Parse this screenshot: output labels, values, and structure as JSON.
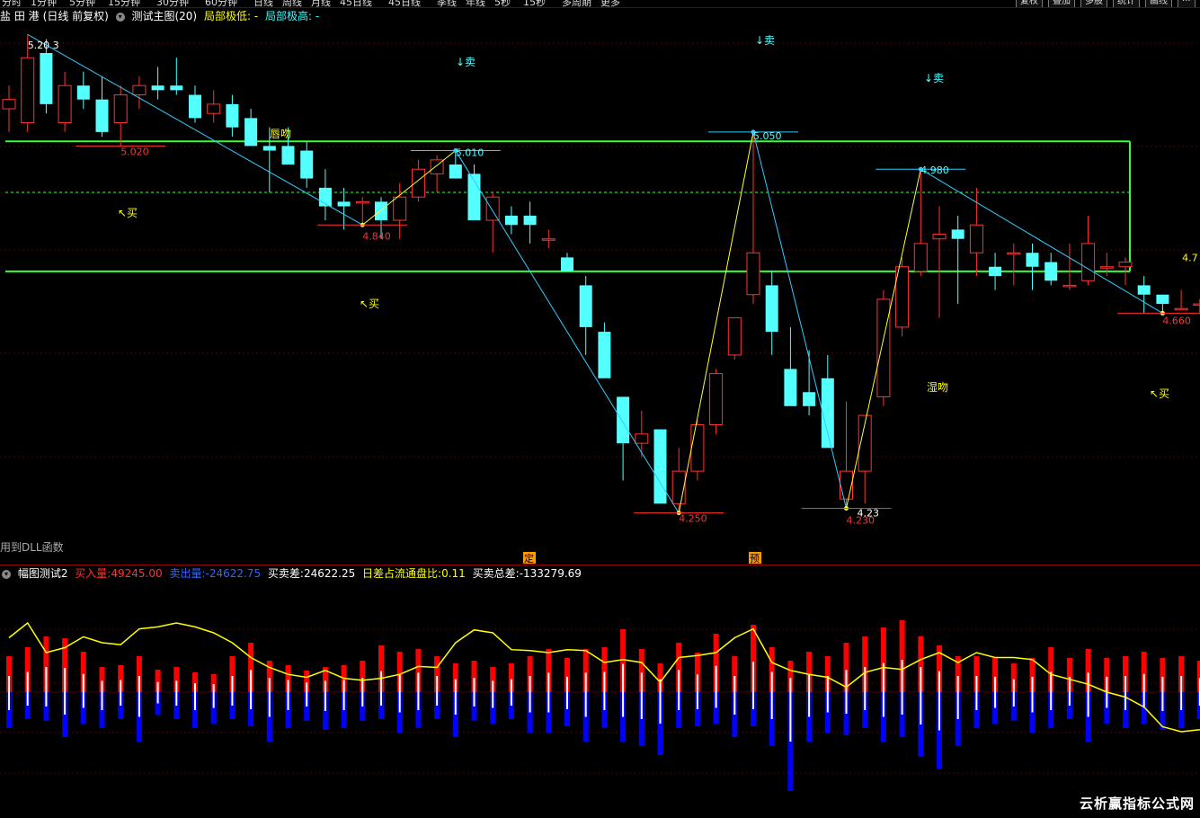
{
  "topbar": {
    "periods": [
      "分时",
      "1分钟",
      "5分钟",
      "15分钟",
      "30分钟",
      "60分钟",
      "日线",
      "周线",
      "月线",
      "45日线",
      "45日线",
      "季线",
      "年线",
      "5秒",
      "15秒",
      "多周期",
      "更多"
    ],
    "right_buttons": [
      "复权",
      "叠加",
      "多股",
      "统计",
      "画线",
      "···"
    ]
  },
  "main_header": {
    "stock_name": "盐 田 港",
    "mode": "(日线 前复权)",
    "indicator": "测试主图(20)",
    "low_label": "局部极低: -",
    "high_label": "局部极高: -",
    "colors": {
      "name": "#ffffff",
      "indicator": "#ffffff",
      "low": "#ffff00",
      "high": "#33ffff"
    }
  },
  "dll_note": "用到DLL函数",
  "ind_header": {
    "name": "幅图测试2",
    "buy_label": "买入量:",
    "buy_value": "49245.00",
    "sell_label": "卖出量:",
    "sell_value": "-24622.75",
    "diff_label": "买卖差:",
    "diff_value": "24622.25",
    "ratio_label": "日差占流通盘比:",
    "ratio_value": "0.11",
    "total_label": "买卖总差:",
    "total_value": "-133279.69"
  },
  "watermark": "云析赢指标公式网",
  "chart_data": {
    "type": "candlestick",
    "price_labels": {
      "p1": "5.20 3",
      "p2": "5.020",
      "p3": "4.840",
      "p4": "5.010",
      "p5": "4.250",
      "p6": "5.050",
      "p7": "4.23",
      "p8": "4.230",
      "p9": "4.980",
      "p10": "4.660",
      "p11": "4.7"
    },
    "annotations": {
      "sell1": "↓卖",
      "sell2": "↓卖",
      "sell3": "↓卖",
      "buy1": "↖买",
      "buy2": "↖买",
      "buy3": "↖买",
      "kiss1": "唇吻",
      "kiss2": "湿吻",
      "mark1": "定",
      "mark2": "预"
    },
    "box": {
      "top": 5.03,
      "bottom": 4.75,
      "mid": 4.92
    },
    "ylim": [
      4.15,
      5.28
    ],
    "colors": {
      "up": "#ff3333",
      "down": "#54ffff",
      "box": "#33ff33",
      "wave": "#33ccff",
      "wave_up": "#ffff33",
      "yellow_line": "#ffff00",
      "buy_bar": "#ff0000",
      "sell_bar": "#0000ff"
    },
    "candles": [
      {
        "o": 5.1,
        "h": 5.15,
        "l": 5.05,
        "c": 5.12
      },
      {
        "o": 5.07,
        "h": 5.26,
        "l": 5.05,
        "c": 5.21
      },
      {
        "o": 5.22,
        "h": 5.25,
        "l": 5.09,
        "c": 5.11
      },
      {
        "o": 5.07,
        "h": 5.18,
        "l": 5.05,
        "c": 5.15
      },
      {
        "o": 5.15,
        "h": 5.18,
        "l": 5.1,
        "c": 5.12
      },
      {
        "o": 5.12,
        "h": 5.17,
        "l": 5.04,
        "c": 5.05
      },
      {
        "o": 5.07,
        "h": 5.15,
        "l": 5.02,
        "c": 5.13
      },
      {
        "o": 5.13,
        "h": 5.17,
        "l": 5.1,
        "c": 5.15
      },
      {
        "o": 5.15,
        "h": 5.19,
        "l": 5.12,
        "c": 5.14
      },
      {
        "o": 5.15,
        "h": 5.21,
        "l": 5.13,
        "c": 5.14
      },
      {
        "o": 5.13,
        "h": 5.15,
        "l": 5.07,
        "c": 5.08
      },
      {
        "o": 5.09,
        "h": 5.14,
        "l": 5.07,
        "c": 5.11
      },
      {
        "o": 5.11,
        "h": 5.13,
        "l": 5.04,
        "c": 5.06
      },
      {
        "o": 5.08,
        "h": 5.1,
        "l": 5.02,
        "c": 5.02
      },
      {
        "o": 5.02,
        "h": 5.06,
        "l": 4.92,
        "c": 5.01
      },
      {
        "o": 5.02,
        "h": 5.06,
        "l": 4.99,
        "c": 4.98
      },
      {
        "o": 5.01,
        "h": 5.03,
        "l": 4.93,
        "c": 4.95
      },
      {
        "o": 4.93,
        "h": 4.97,
        "l": 4.86,
        "c": 4.89
      },
      {
        "o": 4.9,
        "h": 4.93,
        "l": 4.84,
        "c": 4.89
      },
      {
        "o": 4.9,
        "h": 4.91,
        "l": 4.85,
        "c": 4.9
      },
      {
        "o": 4.9,
        "h": 4.91,
        "l": 4.82,
        "c": 4.86
      },
      {
        "o": 4.86,
        "h": 4.94,
        "l": 4.82,
        "c": 4.91
      },
      {
        "o": 4.91,
        "h": 4.99,
        "l": 4.9,
        "c": 4.97
      },
      {
        "o": 4.96,
        "h": 5.0,
        "l": 4.92,
        "c": 4.99
      },
      {
        "o": 4.98,
        "h": 5.01,
        "l": 4.95,
        "c": 4.95
      },
      {
        "o": 4.96,
        "h": 4.98,
        "l": 4.88,
        "c": 4.86
      },
      {
        "o": 4.86,
        "h": 4.92,
        "l": 4.79,
        "c": 4.91
      },
      {
        "o": 4.87,
        "h": 4.89,
        "l": 4.83,
        "c": 4.85
      },
      {
        "o": 4.87,
        "h": 4.9,
        "l": 4.81,
        "c": 4.85
      },
      {
        "o": 4.82,
        "h": 4.84,
        "l": 4.8,
        "c": 4.82
      },
      {
        "o": 4.78,
        "h": 4.79,
        "l": 4.75,
        "c": 4.75
      },
      {
        "o": 4.72,
        "h": 4.74,
        "l": 4.57,
        "c": 4.63
      },
      {
        "o": 4.62,
        "h": 4.64,
        "l": 4.55,
        "c": 4.52
      },
      {
        "o": 4.48,
        "h": 4.48,
        "l": 4.3,
        "c": 4.38
      },
      {
        "o": 4.38,
        "h": 4.45,
        "l": 4.35,
        "c": 4.4
      },
      {
        "o": 4.41,
        "h": 4.41,
        "l": 4.26,
        "c": 4.25
      },
      {
        "o": 4.25,
        "h": 4.37,
        "l": 4.23,
        "c": 4.32
      },
      {
        "o": 4.32,
        "h": 4.43,
        "l": 4.3,
        "c": 4.42
      },
      {
        "o": 4.42,
        "h": 4.54,
        "l": 4.4,
        "c": 4.53
      },
      {
        "o": 4.57,
        "h": 4.63,
        "l": 4.56,
        "c": 4.65
      },
      {
        "o": 4.7,
        "h": 5.05,
        "l": 4.68,
        "c": 4.79
      },
      {
        "o": 4.72,
        "h": 4.75,
        "l": 4.57,
        "c": 4.62
      },
      {
        "o": 4.54,
        "h": 4.63,
        "l": 4.49,
        "c": 4.46
      },
      {
        "o": 4.49,
        "h": 4.58,
        "l": 4.44,
        "c": 4.46
      },
      {
        "o": 4.52,
        "h": 4.57,
        "l": 4.39,
        "c": 4.37
      },
      {
        "o": 4.26,
        "h": 4.47,
        "l": 4.24,
        "c": 4.32
      },
      {
        "o": 4.32,
        "h": 4.44,
        "l": 4.25,
        "c": 4.44
      },
      {
        "o": 4.48,
        "h": 4.71,
        "l": 4.46,
        "c": 4.69
      },
      {
        "o": 4.63,
        "h": 4.78,
        "l": 4.61,
        "c": 4.76
      },
      {
        "o": 4.75,
        "h": 4.97,
        "l": 4.74,
        "c": 4.81
      },
      {
        "o": 4.82,
        "h": 4.89,
        "l": 4.65,
        "c": 4.83
      },
      {
        "o": 4.84,
        "h": 4.87,
        "l": 4.68,
        "c": 4.82
      },
      {
        "o": 4.79,
        "h": 4.93,
        "l": 4.74,
        "c": 4.85
      },
      {
        "o": 4.76,
        "h": 4.79,
        "l": 4.71,
        "c": 4.74
      },
      {
        "o": 4.79,
        "h": 4.81,
        "l": 4.72,
        "c": 4.79
      },
      {
        "o": 4.79,
        "h": 4.81,
        "l": 4.71,
        "c": 4.76
      },
      {
        "o": 4.77,
        "h": 4.79,
        "l": 4.72,
        "c": 4.73
      },
      {
        "o": 4.72,
        "h": 4.81,
        "l": 4.71,
        "c": 4.72
      },
      {
        "o": 4.73,
        "h": 4.87,
        "l": 4.72,
        "c": 4.81
      },
      {
        "o": 4.76,
        "h": 4.79,
        "l": 4.74,
        "c": 4.76
      },
      {
        "o": 4.76,
        "h": 4.78,
        "l": 4.72,
        "c": 4.77
      },
      {
        "o": 4.72,
        "h": 4.74,
        "l": 4.66,
        "c": 4.7
      },
      {
        "o": 4.7,
        "h": 4.7,
        "l": 4.66,
        "c": 4.68
      },
      {
        "o": 4.67,
        "h": 4.71,
        "l": 4.67,
        "c": 4.67
      },
      {
        "o": 4.68,
        "h": 4.69,
        "l": 4.66,
        "c": 4.68
      },
      {
        "o": 4.66,
        "h": 4.71,
        "l": 4.66,
        "c": 4.7
      }
    ],
    "volume_buy": [
      40,
      50,
      62,
      60,
      45,
      28,
      30,
      40,
      25,
      28,
      22,
      20,
      40,
      55,
      35,
      30,
      24,
      28,
      30,
      35,
      52,
      45,
      48,
      40,
      32,
      35,
      28,
      32,
      40,
      48,
      38,
      48,
      50,
      70,
      48,
      32,
      55,
      44,
      65,
      40,
      75,
      50,
      35,
      45,
      40,
      55,
      62,
      72,
      80,
      62,
      52,
      40,
      40,
      38,
      32,
      38,
      50,
      38,
      48,
      38,
      40,
      45,
      38,
      40,
      35,
      40
    ],
    "volume_sell": [
      40,
      30,
      32,
      50,
      35,
      40,
      30,
      55,
      25,
      30,
      40,
      35,
      30,
      38,
      55,
      40,
      32,
      42,
      40,
      32,
      30,
      45,
      40,
      30,
      50,
      32,
      35,
      30,
      45,
      45,
      38,
      55,
      40,
      55,
      60,
      70,
      40,
      38,
      35,
      50,
      38,
      60,
      110,
      55,
      45,
      48,
      40,
      55,
      50,
      72,
      85,
      60,
      40,
      35,
      32,
      45,
      40,
      30,
      55,
      35,
      40,
      35,
      42,
      40,
      30,
      20
    ],
    "ind_line": [
      0.55,
      0.7,
      0.4,
      0.45,
      0.56,
      0.5,
      0.48,
      0.64,
      0.66,
      0.7,
      0.66,
      0.6,
      0.5,
      0.35,
      0.25,
      0.18,
      0.15,
      0.22,
      0.14,
      0.12,
      0.14,
      0.18,
      0.26,
      0.25,
      0.5,
      0.63,
      0.6,
      0.43,
      0.42,
      0.4,
      0.43,
      0.42,
      0.3,
      0.33,
      0.3,
      0.1,
      0.35,
      0.37,
      0.4,
      0.55,
      0.64,
      0.3,
      0.22,
      0.18,
      0.15,
      0.05,
      0.2,
      0.25,
      0.23,
      0.33,
      0.4,
      0.3,
      0.4,
      0.35,
      0.35,
      0.33,
      0.18,
      0.13,
      0.08,
      0.0,
      -0.05,
      -0.15,
      -0.35,
      -0.4,
      -0.38,
      -0.35
    ]
  }
}
